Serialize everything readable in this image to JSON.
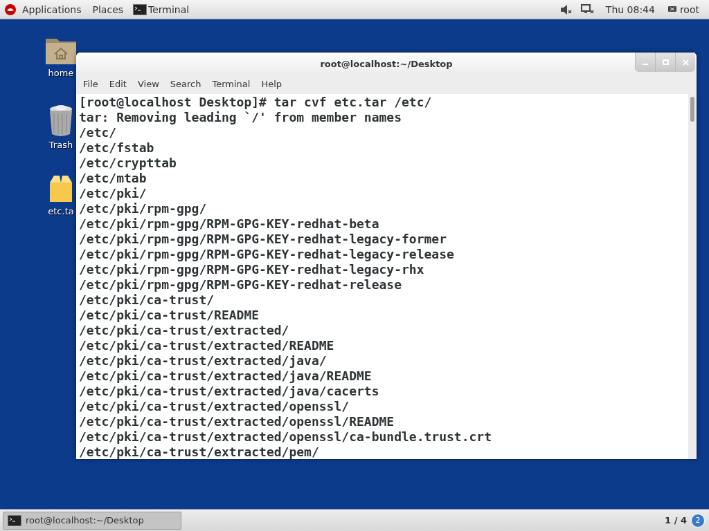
{
  "top_bar": {
    "applications": "Applications",
    "places": "Places",
    "active_app": "Terminal",
    "clock": "Thu 08:44",
    "user": "root"
  },
  "desktop_icons": [
    {
      "kind": "home",
      "label": "home"
    },
    {
      "kind": "trash",
      "label": "Trash"
    },
    {
      "kind": "archive",
      "label": "etc.ta"
    }
  ],
  "window": {
    "title": "root@localhost:~/Desktop",
    "menu": [
      "File",
      "Edit",
      "View",
      "Search",
      "Terminal",
      "Help"
    ],
    "lines": [
      "[root@localhost Desktop]# tar cvf etc.tar /etc/",
      "tar: Removing leading `/' from member names",
      "/etc/",
      "/etc/fstab",
      "/etc/crypttab",
      "/etc/mtab",
      "/etc/pki/",
      "/etc/pki/rpm-gpg/",
      "/etc/pki/rpm-gpg/RPM-GPG-KEY-redhat-beta",
      "/etc/pki/rpm-gpg/RPM-GPG-KEY-redhat-legacy-former",
      "/etc/pki/rpm-gpg/RPM-GPG-KEY-redhat-legacy-release",
      "/etc/pki/rpm-gpg/RPM-GPG-KEY-redhat-legacy-rhx",
      "/etc/pki/rpm-gpg/RPM-GPG-KEY-redhat-release",
      "/etc/pki/ca-trust/",
      "/etc/pki/ca-trust/README",
      "/etc/pki/ca-trust/extracted/",
      "/etc/pki/ca-trust/extracted/README",
      "/etc/pki/ca-trust/extracted/java/",
      "/etc/pki/ca-trust/extracted/java/README",
      "/etc/pki/ca-trust/extracted/java/cacerts",
      "/etc/pki/ca-trust/extracted/openssl/",
      "/etc/pki/ca-trust/extracted/openssl/README",
      "/etc/pki/ca-trust/extracted/openssl/ca-bundle.trust.crt",
      "/etc/pki/ca-trust/extracted/pem/"
    ]
  },
  "taskbar": {
    "task": "root@localhost:~/Desktop",
    "workspace": "1 / 4",
    "notifications": "2"
  }
}
